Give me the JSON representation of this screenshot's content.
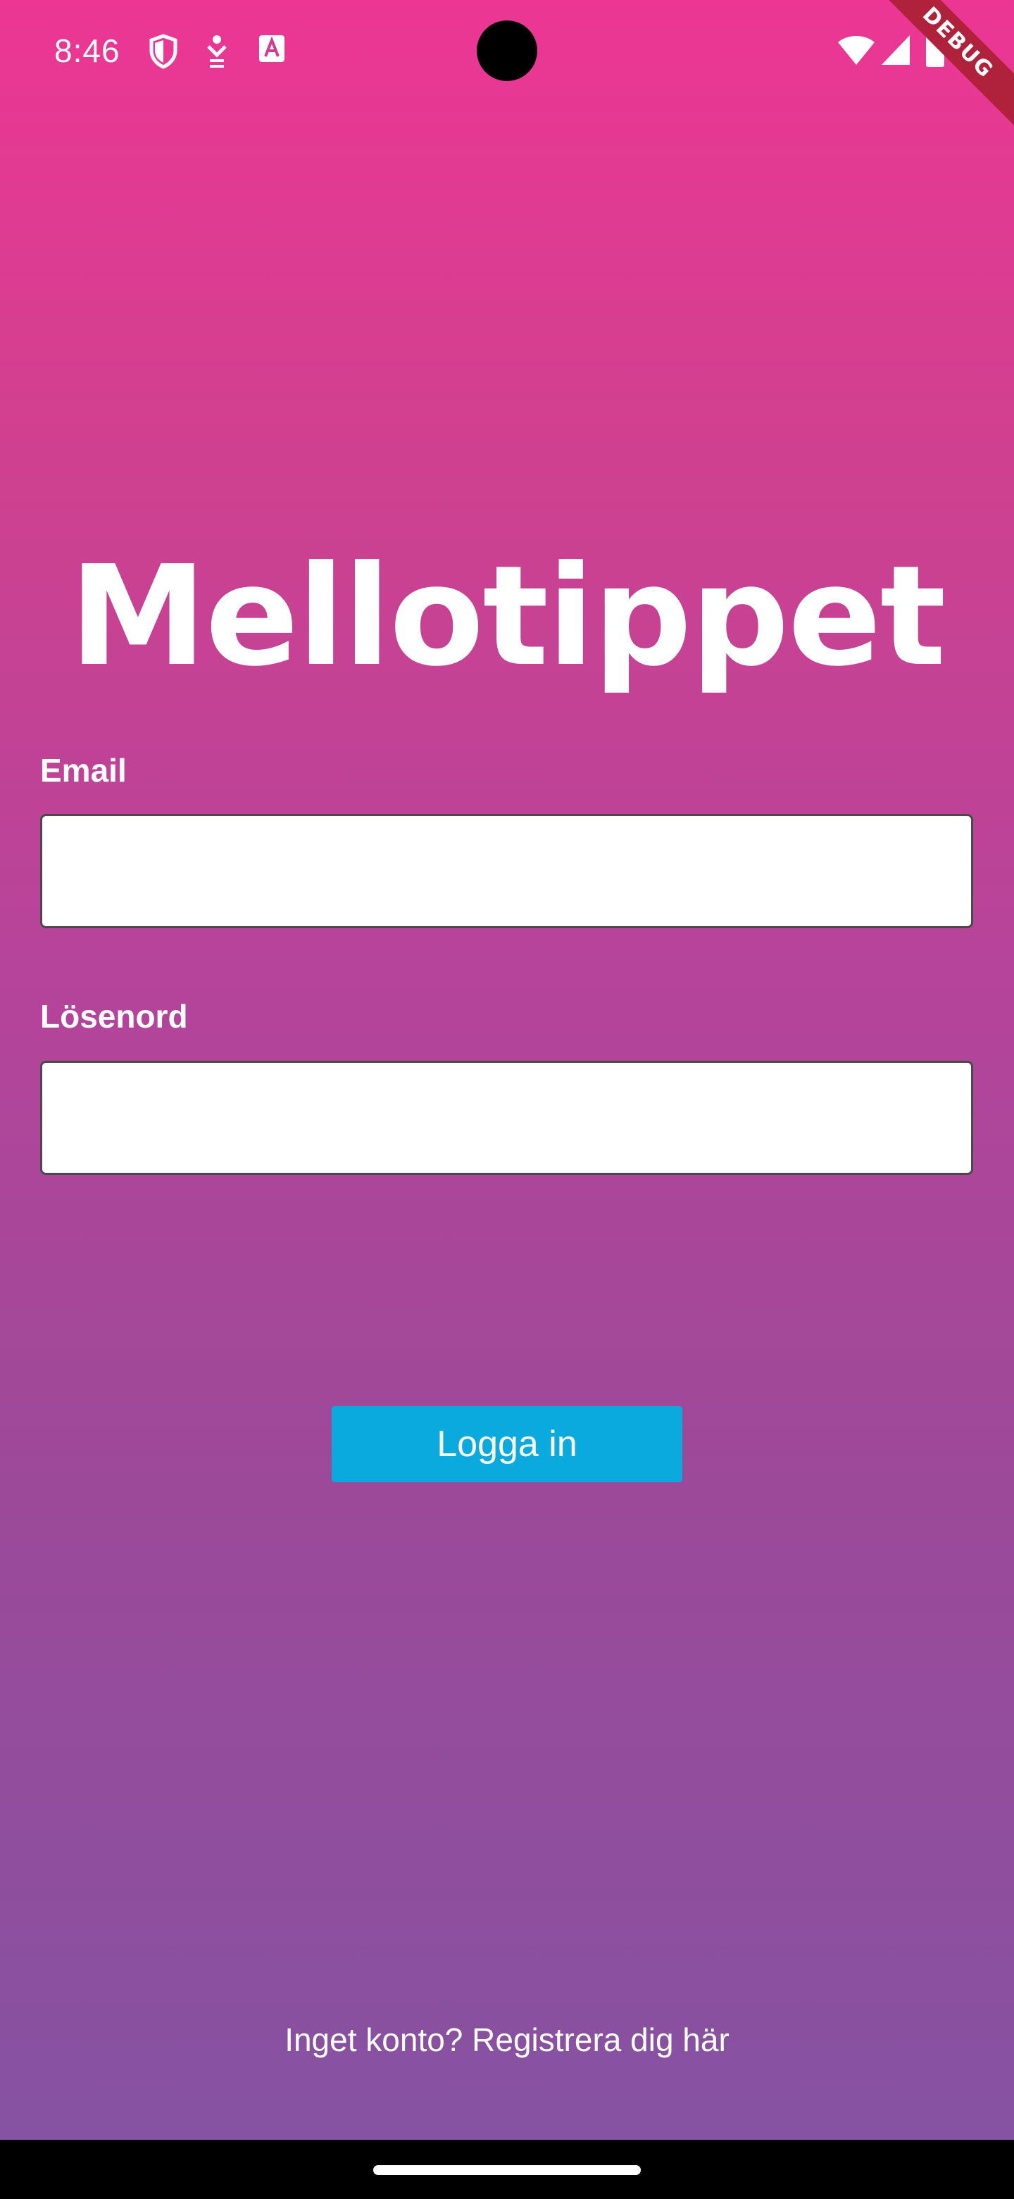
{
  "status_bar": {
    "time": "8:46",
    "left_icons": [
      "shield-icon",
      "accessibility-icon",
      "font-a-icon"
    ],
    "right_icons": [
      "wifi-icon",
      "signal-icon",
      "battery-icon"
    ]
  },
  "debug_banner": "DEBUG",
  "app": {
    "title": "Mellotippet"
  },
  "form": {
    "email_label": "Email",
    "email_value": "",
    "password_label": "Lösenord",
    "password_value": "",
    "login_button": "Logga in"
  },
  "footer": {
    "register_link": "Inget konto? Registrera dig här"
  },
  "colors": {
    "gradient_top": "#ed3694",
    "gradient_bottom": "#8652a2",
    "button": "#0aa9de",
    "debug_banner": "#b0213b"
  }
}
